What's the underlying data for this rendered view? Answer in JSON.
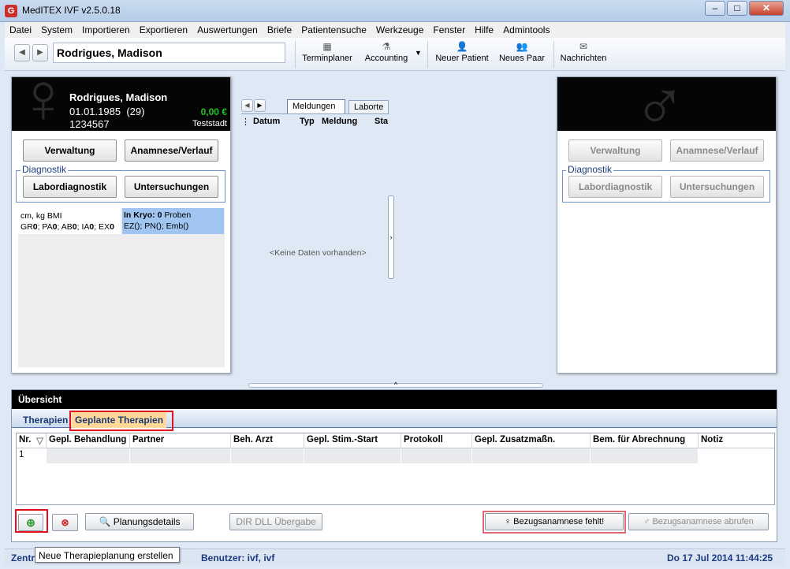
{
  "window": {
    "title": "MedITEX IVF v2.5.0.18",
    "app_icon": "G"
  },
  "menu": [
    "Datei",
    "System",
    "Importieren",
    "Exportieren",
    "Auswertungen",
    "Briefe",
    "Patientensuche",
    "Werkzeuge",
    "Fenster",
    "Hilfe",
    "Admintools"
  ],
  "toolbar": {
    "patient_name": "Rodrigues, Madison",
    "buttons": [
      {
        "label": "Terminplaner",
        "icon": "calendar-icon"
      },
      {
        "label": "Accounting",
        "icon": "flask-icon"
      },
      {
        "label": "Neuer Patient",
        "icon": "add-person-icon"
      },
      {
        "label": "Neues Paar",
        "icon": "couple-icon"
      },
      {
        "label": "Nachrichten",
        "icon": "envelope-icon"
      }
    ]
  },
  "female_panel": {
    "name": "Rodrigues, Madison",
    "dob": "01.01.1985",
    "age": "(29)",
    "id": "1234567",
    "balance": "0,00 €",
    "city": "Teststadt",
    "btn_verwaltung": "Verwaltung",
    "btn_anamnese": "Anamnese/Verlauf",
    "group_label": "Diagnostik",
    "btn_labor": "Labordiagnostik",
    "btn_untersuchungen": "Untersuchungen",
    "info_line1": "cm, kg BMI",
    "info_line2_parts": [
      "GR",
      "0",
      "; PA",
      "0",
      "; AB",
      "0",
      "; IA",
      "0",
      "; EX",
      "0"
    ],
    "kryo_label": "In Kryo:",
    "kryo_count": "0",
    "kryo_suffix": "Proben",
    "kryo_line2": "EZ(); PN(); Emb()"
  },
  "center": {
    "tabs": [
      "Meldungen",
      "Laborte"
    ],
    "columns": [
      "Datum",
      "Typ",
      "Meldung",
      "Sta"
    ],
    "empty": "<Keine Daten vorhanden>"
  },
  "male_panel": {
    "btn_verwaltung": "Verwaltung",
    "btn_anamnese": "Anamnese/Verlauf",
    "group_label": "Diagnostik",
    "btn_labor": "Labordiagnostik",
    "btn_untersuchungen": "Untersuchungen"
  },
  "overview": {
    "title": "Übersicht",
    "tabs": [
      "Therapien",
      "Geplante Therapien"
    ],
    "columns": [
      "Nr.",
      "Gepl. Behandlung",
      "Partner",
      "Beh. Arzt",
      "Gepl. Stim.-Start",
      "Protokoll",
      "Gepl. Zusatzmaßn.",
      "Bem. für Abrechnung",
      "Notiz"
    ],
    "rows": [
      [
        "1",
        "",
        "",
        "",
        "",
        "",
        "",
        "",
        ""
      ]
    ],
    "btn_planung": "Planungsdetails",
    "btn_dir": "DIR DLL Übergabe",
    "btn_bezug_missing": "Bezugsanamnese fehlt!",
    "btn_bezug_fetch": "Bezugsanamnese abrufen"
  },
  "tooltip": "Neue Therapieplanung erstellen",
  "statusbar": {
    "left": "Zentr",
    "user": "Benutzer: ivf, ivf",
    "datetime": "Do 17 Jul 2014 11:44:25"
  },
  "colors": {
    "highlight_red": "#e0121c",
    "balance_green": "#22c322",
    "info_blue": "#9fc5f0"
  }
}
